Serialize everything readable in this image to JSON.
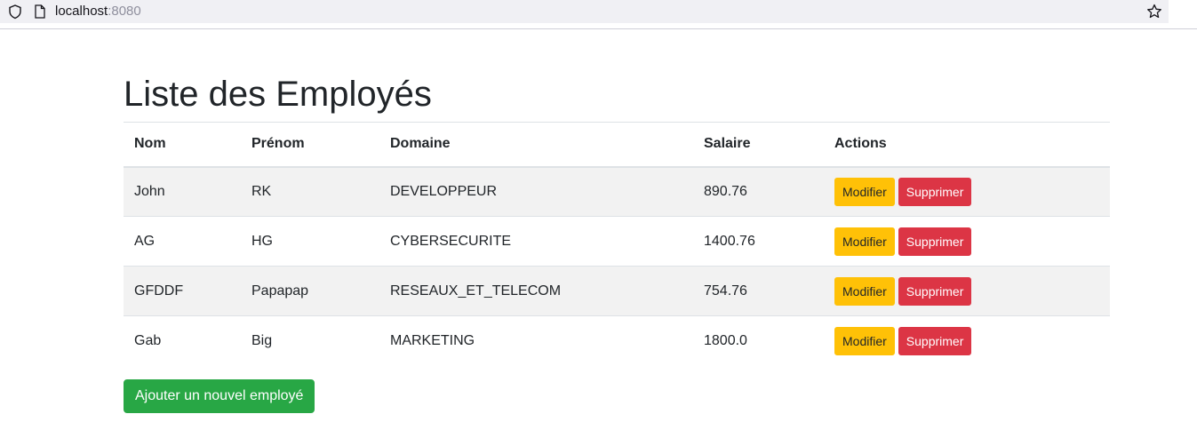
{
  "browser": {
    "url_host": "localhost",
    "url_port": ":8080"
  },
  "page": {
    "title": "Liste des Employés",
    "add_button_label": "Ajouter un nouvel employé"
  },
  "table": {
    "headers": [
      "Nom",
      "Prénom",
      "Domaine",
      "Salaire",
      "Actions"
    ],
    "rows": [
      {
        "nom": "John",
        "prenom": "RK",
        "domaine": "DEVELOPPEUR",
        "salaire": "890.76"
      },
      {
        "nom": "AG",
        "prenom": "HG",
        "domaine": "CYBERSECURITE",
        "salaire": "1400.76"
      },
      {
        "nom": "GFDDF",
        "prenom": "Papapap",
        "domaine": "RESEAUX_ET_TELECOM",
        "salaire": "754.76"
      },
      {
        "nom": "Gab",
        "prenom": "Big",
        "domaine": "MARKETING",
        "salaire": "1800.0"
      }
    ],
    "edit_label": "Modifier",
    "delete_label": "Supprimer"
  },
  "colors": {
    "edit": "#ffc107",
    "delete": "#dc3545",
    "add": "#28a745",
    "stripe": "#f2f2f2"
  }
}
